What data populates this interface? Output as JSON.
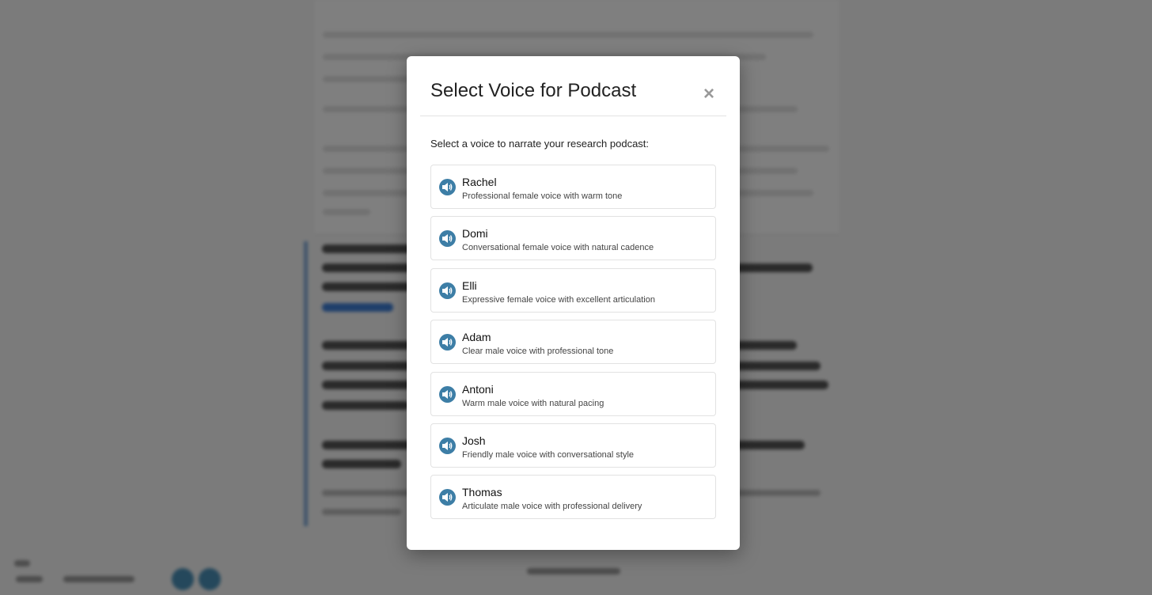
{
  "modal": {
    "title": "Select Voice for Podcast",
    "close_glyph": "×",
    "intro": "Select a voice to narrate your research podcast:",
    "voices": [
      {
        "name": "Rachel",
        "description": "Professional female voice with warm tone"
      },
      {
        "name": "Domi",
        "description": "Conversational female voice with natural cadence"
      },
      {
        "name": "Elli",
        "description": "Expressive female voice with excellent articulation"
      },
      {
        "name": "Adam",
        "description": "Clear male voice with professional tone"
      },
      {
        "name": "Antoni",
        "description": "Warm male voice with natural pacing"
      },
      {
        "name": "Josh",
        "description": "Friendly male voice with conversational style"
      },
      {
        "name": "Thomas",
        "description": "Articulate male voice with professional delivery"
      }
    ]
  },
  "colors": {
    "icon_bg": "#3d7ea6",
    "overlay": "rgba(0,0,0,0.5)"
  },
  "icons": {
    "voice": "speaker-icon",
    "close": "close-icon"
  }
}
